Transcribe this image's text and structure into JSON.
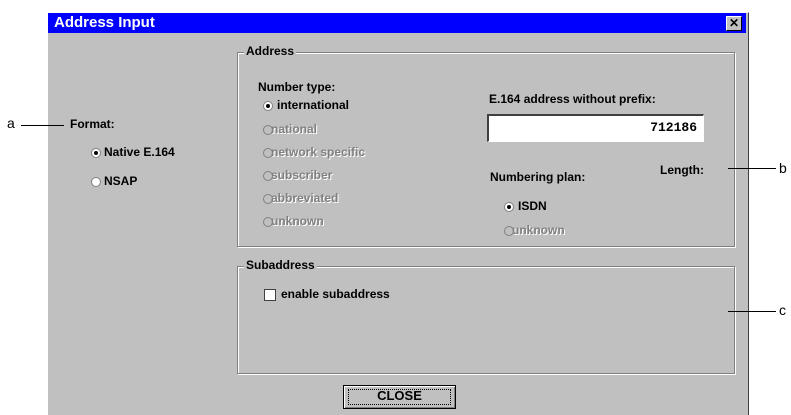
{
  "window": {
    "title": "Address Input",
    "close_glyph": "✕"
  },
  "format": {
    "label": "Format:",
    "options": [
      {
        "label": "Native E.164",
        "selected": true
      },
      {
        "label": "NSAP",
        "selected": false
      }
    ]
  },
  "address": {
    "group_label": "Address",
    "number_type_label": "Number type:",
    "number_types": [
      {
        "label": "international",
        "selected": true,
        "enabled": true
      },
      {
        "label": "national",
        "selected": false,
        "enabled": false
      },
      {
        "label": "network specific",
        "selected": false,
        "enabled": false
      },
      {
        "label": "subscriber",
        "selected": false,
        "enabled": false
      },
      {
        "label": "abbreviated",
        "selected": false,
        "enabled": false
      },
      {
        "label": "unknown",
        "selected": false,
        "enabled": false
      }
    ],
    "e164_label": "E.164 address without prefix:",
    "e164_value": "712186",
    "length_label": "Length:",
    "numbering_plan_label": "Numbering plan:",
    "numbering_plans": [
      {
        "label": "ISDN",
        "selected": true,
        "enabled": true
      },
      {
        "label": "unknown",
        "selected": false,
        "enabled": false
      }
    ]
  },
  "subaddress": {
    "group_label": "Subaddress",
    "enable_label": "enable subaddress",
    "enabled": false
  },
  "buttons": {
    "close": "CLOSE"
  },
  "callouts": {
    "a": "a",
    "b": "b",
    "c": "c"
  }
}
